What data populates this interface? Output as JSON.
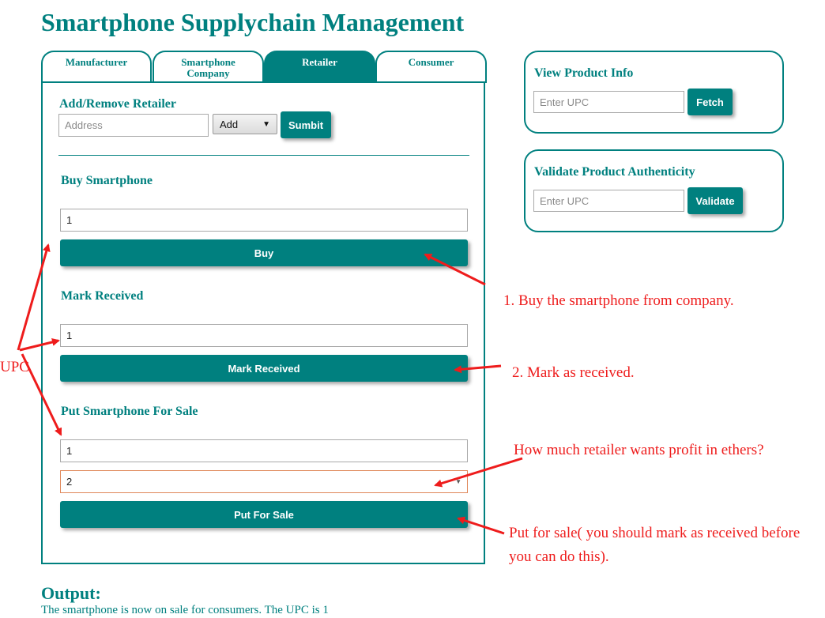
{
  "app": {
    "title": "Smartphone Supplychain Management"
  },
  "tabs": [
    {
      "label": "Manufacturer"
    },
    {
      "label": "Smartphone Company"
    },
    {
      "label": "Retailer"
    },
    {
      "label": "Consumer"
    }
  ],
  "add_remove": {
    "heading": "Add/Remove Retailer",
    "address_placeholder": "Address",
    "select_value": "Add",
    "submit_label": "Sumbit"
  },
  "buy": {
    "heading": "Buy Smartphone",
    "upc_value": "1",
    "button_label": "Buy"
  },
  "mark_received": {
    "heading": "Mark Received",
    "upc_value": "1",
    "button_label": "Mark Received"
  },
  "for_sale": {
    "heading": "Put Smartphone For Sale",
    "upc_value": "1",
    "price_value": "2",
    "button_label": "Put For Sale"
  },
  "view_info": {
    "heading": "View Product Info",
    "upc_placeholder": "Enter UPC",
    "button_label": "Fetch"
  },
  "validate": {
    "heading": "Validate Product Authenticity",
    "upc_placeholder": "Enter UPC",
    "button_label": "Validate"
  },
  "output": {
    "heading": "Output:",
    "message": "The smartphone is now on sale for consumers. The UPC is 1"
  },
  "annotations": {
    "upc": "UPC",
    "step1": "1. Buy the smartphone from company.",
    "step2": "2. Mark as received.",
    "profit": "How much retailer wants profit in ethers?",
    "put_sale_line1": "Put for sale( you should mark as received before",
    "put_sale_line2": "you can do this)."
  },
  "colors": {
    "accent": "#00807f",
    "annotation": "#ee1c1c"
  }
}
